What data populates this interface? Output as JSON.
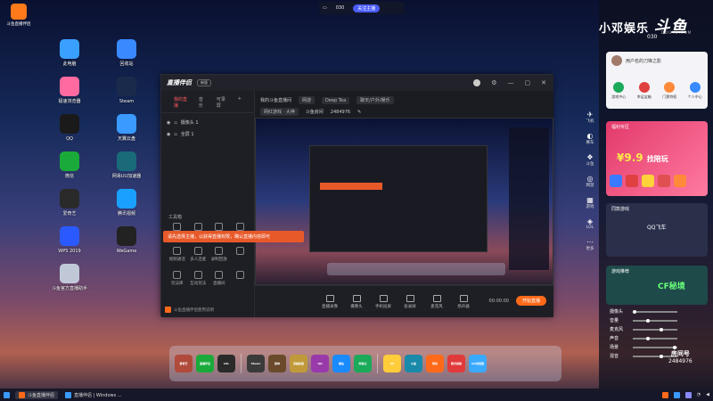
{
  "desktop": {
    "shortcut": "斗鱼直播伴侣",
    "icons_col1": [
      "此电脑",
      "极速浏览器",
      "QQ",
      "微信",
      "爱奇艺",
      "WPS 2019",
      "斗鱼官方直播助手"
    ],
    "icons_col2": [
      "回收站",
      "Steam",
      "天翼云盘",
      "网易UU加速器",
      "腾讯视频",
      "WeGame"
    ]
  },
  "topbar": {
    "count": "030",
    "button": "关注主播"
  },
  "app": {
    "logo": "直播伴侣",
    "version": "新版",
    "tabs": [
      "我的直播",
      "音乐",
      "可录屏"
    ],
    "scenes": [
      "摄像头 1",
      "全屏 1"
    ],
    "tools_label": "工具箱",
    "tools": [
      "投屏",
      "连麦",
      "弹幕",
      "PK",
      "视频通话",
      "多人连麦",
      "录制回放",
      "",
      "玩法库",
      "互动玩法",
      "直播间",
      ""
    ],
    "live_title": "我的斗鱼直播间",
    "tags": [
      "网游",
      "Deep Tea",
      "聊天/户外/娱乐"
    ],
    "room_status": "网红游戏 · 大神",
    "room_label": "斗鱼房间",
    "room_id": "2484976",
    "toast": "请先选择主播，以获得直播权限，确认直播内容即可",
    "buttons": [
      "直播录像",
      "摄像头",
      "手机投屏",
      "投录屏",
      "麦克风",
      "扬声器"
    ],
    "timer": "00:00:00",
    "start": "开始直播",
    "notice": "斗鱼直播伴侣使用说明"
  },
  "dock": [
    "爱奇艺",
    "直播伴侣",
    "LOL",
    "Steam",
    "原神",
    "英雄联盟",
    "QQ",
    "微信",
    "网易云",
    "UU",
    "斗鱼",
    "网易",
    "腾讯视频",
    "QQ浏览器"
  ],
  "taskbar": {
    "tasks": [
      "斗鱼直播伴侣",
      "直播伴侣 | Windows ..."
    ]
  },
  "right_panel": {
    "brand": "小邓娱乐",
    "douyu": "斗鱼",
    "douyu_sub": "DOUYU.COM",
    "count": "030",
    "user": "用户名的刀锋之影",
    "quick": [
      "游戏中心",
      "幸运宝箱",
      "门票特权",
      "个人中心"
    ],
    "promo_head": "福利专区",
    "promo_price": "¥9.9",
    "promo_text": "找陪玩",
    "game_head": "同款游戏",
    "game_name": "QQ飞车",
    "game2_head": "游戏推荐",
    "game2_name": "CF秘境",
    "side_items": [
      "飞机",
      "赛车",
      "斗鱼",
      "网游",
      "游戏",
      "LOL",
      "更多"
    ],
    "audio_labels": [
      "摄像头",
      "音量",
      "麦克风",
      "声音",
      "场景",
      "混音"
    ],
    "room_id": "2484976",
    "room_label": "房间号"
  },
  "colors": {
    "accent": "#ff6a1a",
    "toast": "#e8592a",
    "brand_blue": "#4a5cff"
  }
}
